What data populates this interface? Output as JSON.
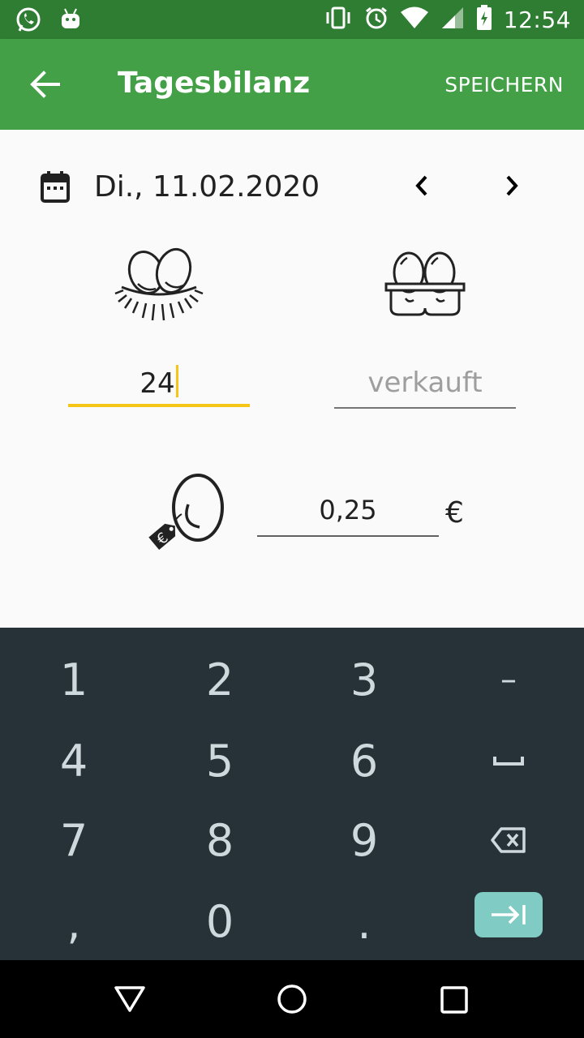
{
  "status_bar": {
    "time": "12:54",
    "left_icons": [
      "whatsapp-icon",
      "android-icon"
    ],
    "right_icons": [
      "vibrate-icon",
      "alarm-icon",
      "wifi-icon",
      "signal-icon",
      "battery-charging-icon"
    ]
  },
  "app_bar": {
    "title": "Tagesbilanz",
    "action_label": "SPEICHERN",
    "back_icon": "arrow-back-icon",
    "background": "#43a047",
    "status_background": "#2e7d32"
  },
  "date_row": {
    "date": "Di., 11.02.2020",
    "calendar_icon": "calendar-icon",
    "prev_icon": "chevron-left-icon",
    "next_icon": "chevron-right-icon"
  },
  "inputs": {
    "laid_value": "24",
    "sold_placeholder": "verkauft",
    "price_value": "0,25",
    "currency": "€",
    "focus_color": "#f5c518"
  },
  "keyboard": {
    "keys": [
      [
        "1",
        "2",
        "3",
        "–"
      ],
      [
        "4",
        "5",
        "6",
        "space"
      ],
      [
        "7",
        "8",
        "9",
        "backspace"
      ],
      [
        ",",
        "0",
        ".",
        "tab"
      ]
    ],
    "tab_color": "#80cbc4",
    "background": "#263238"
  },
  "nav_bar": {
    "icons": [
      "back-triangle-icon",
      "home-circle-icon",
      "recents-square-icon"
    ]
  }
}
